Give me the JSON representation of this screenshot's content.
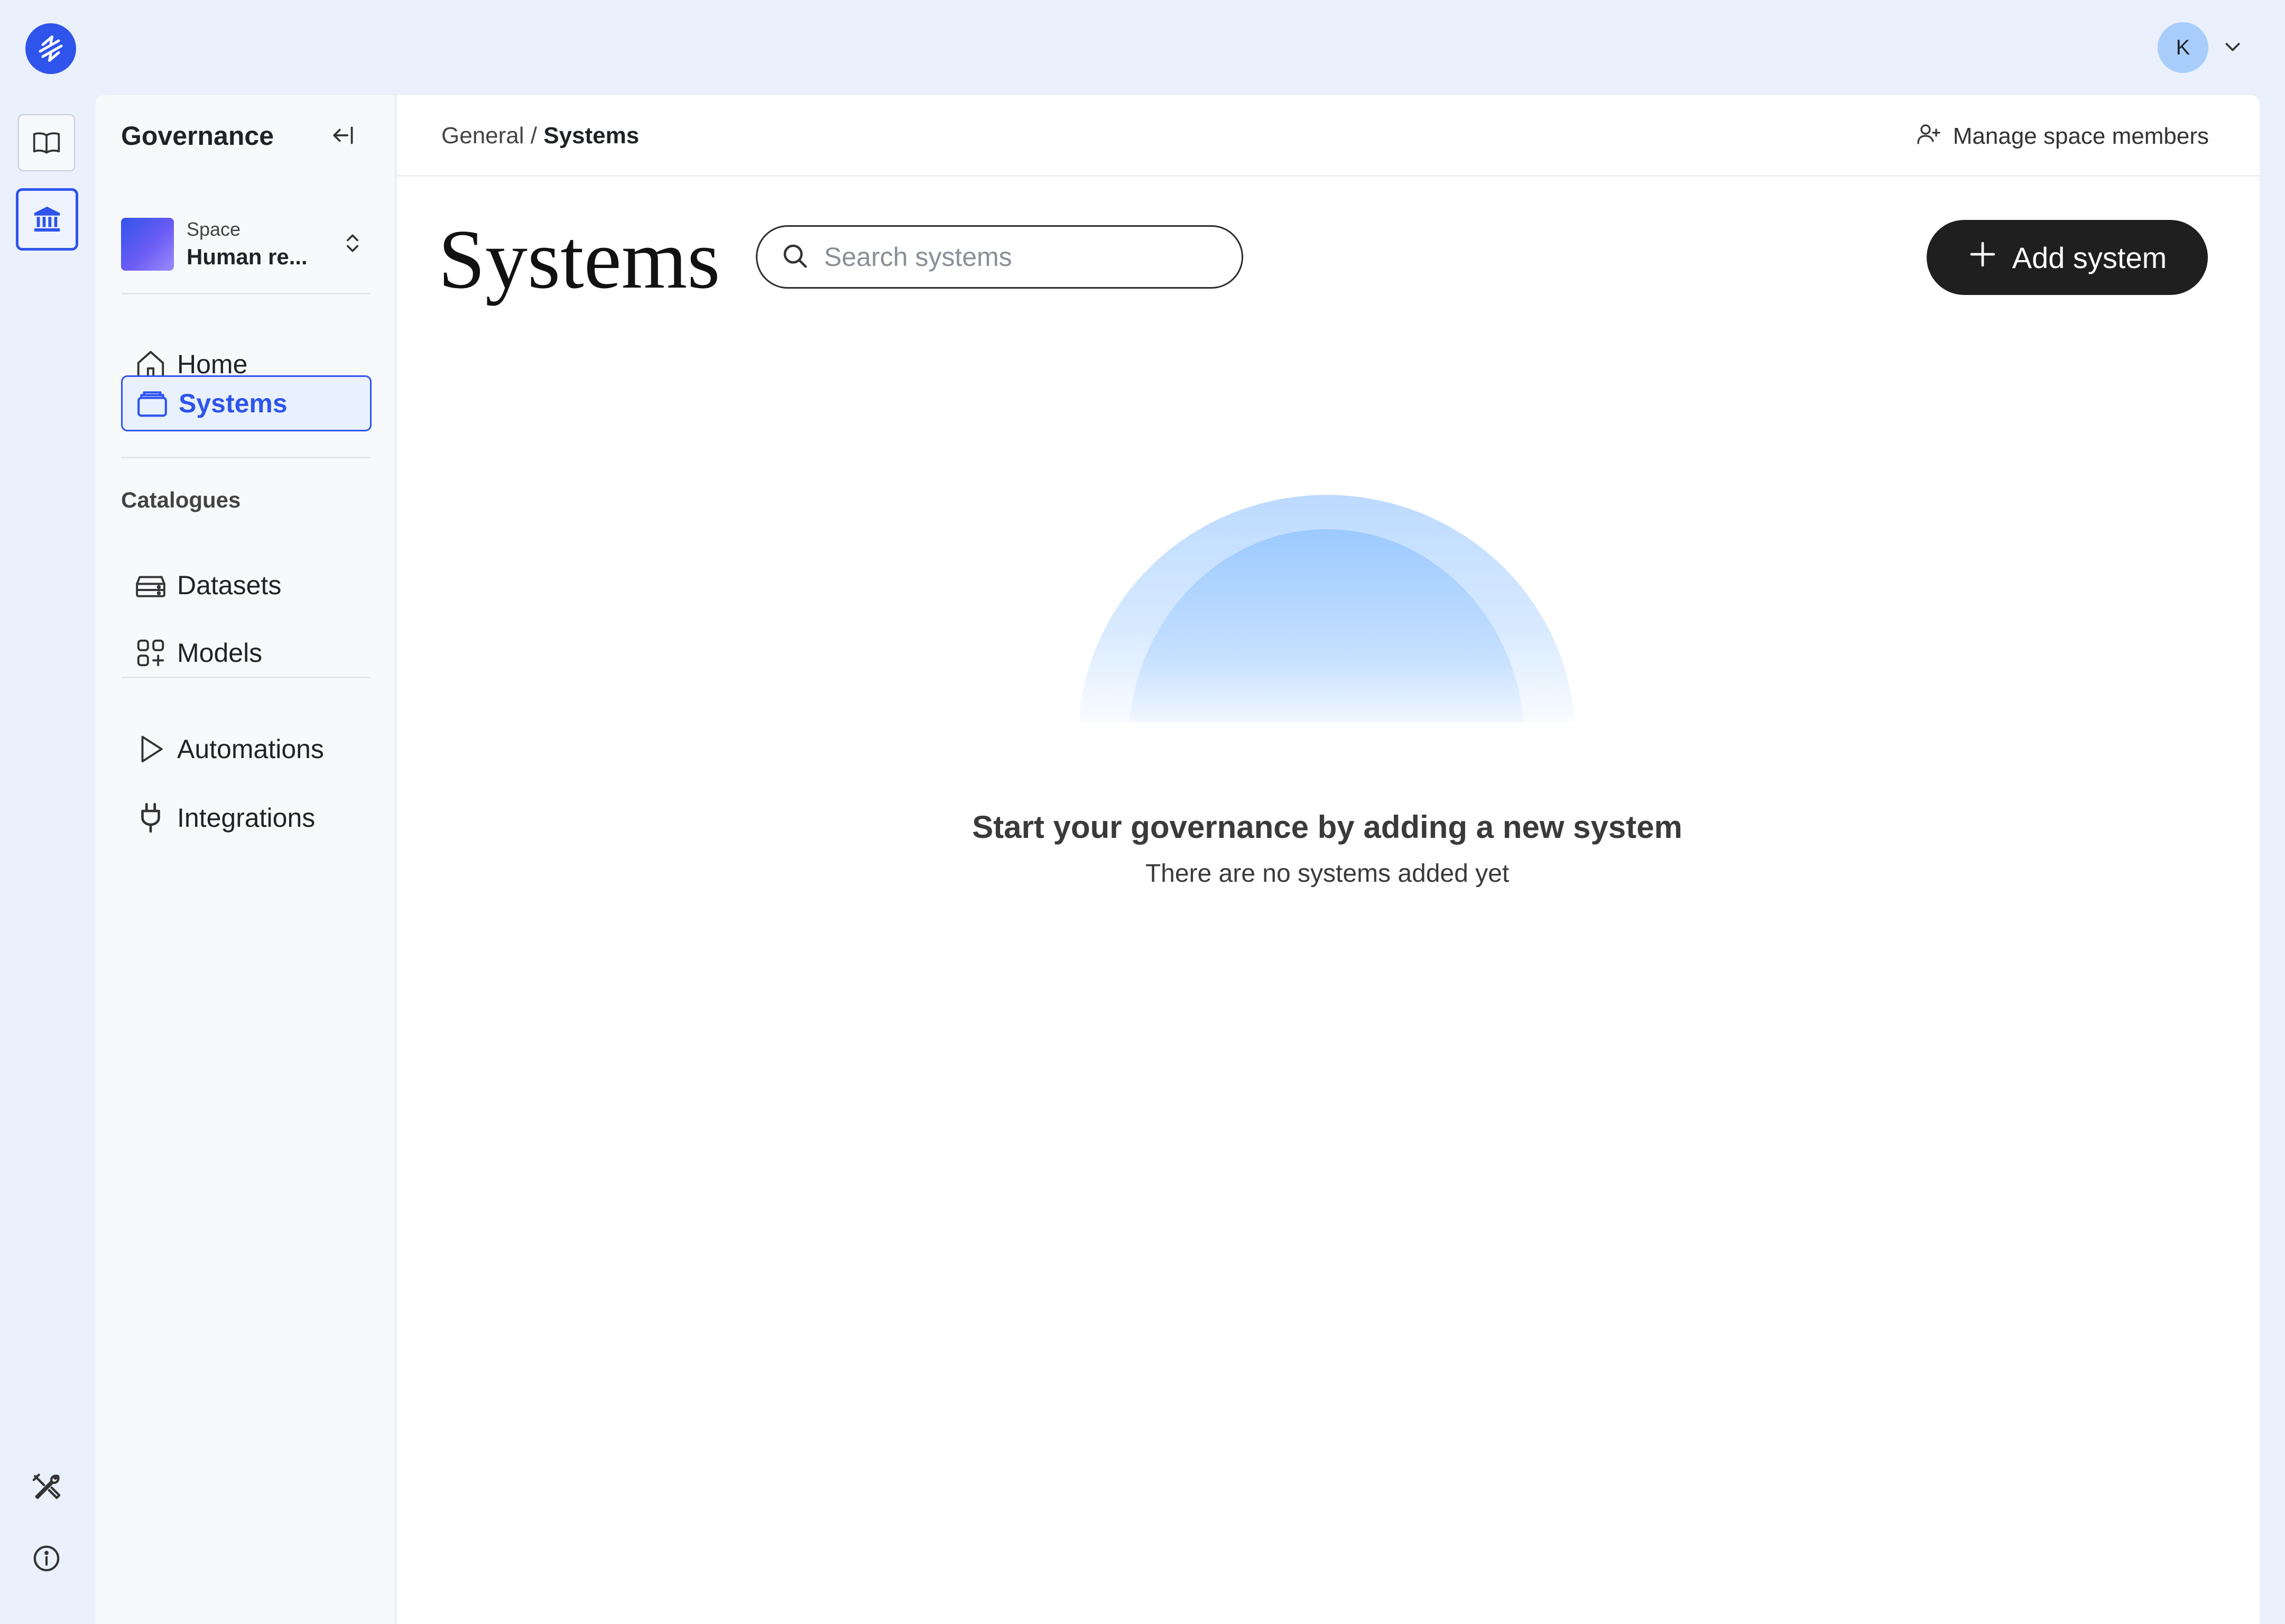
{
  "topbar": {
    "avatar_initial": "K"
  },
  "sidebar": {
    "title": "Governance",
    "space": {
      "label": "Space",
      "name": "Human re..."
    },
    "nav": [
      {
        "label": "Home"
      },
      {
        "label": "Systems",
        "active": true
      }
    ],
    "catalogues_label": "Catalogues",
    "catalogues": [
      {
        "label": "Datasets"
      },
      {
        "label": "Models"
      }
    ],
    "tools": [
      {
        "label": "Automations"
      },
      {
        "label": "Integrations"
      }
    ]
  },
  "main": {
    "breadcrumb": {
      "parent": "General",
      "separator": " / ",
      "current": "Systems"
    },
    "manage_members": "Manage space members",
    "title": "Systems",
    "search": {
      "placeholder": "Search systems",
      "value": ""
    },
    "add_button": "Add system",
    "empty_state": {
      "title": "Start your governance by adding a new system",
      "subtitle": "There are no systems added yet"
    }
  },
  "colors": {
    "accent": "#2f54eb",
    "background": "#eaf1fd",
    "button_dark": "#1f1f1f",
    "avatar": "#a9cdfb"
  },
  "icons": [
    "logo-icon",
    "book-icon",
    "bank-icon",
    "tools-icon",
    "info-icon",
    "chevron-down-icon",
    "collapse-sidebar-icon",
    "updown-chevron-icon",
    "home-icon",
    "systems-icon",
    "datasets-icon",
    "models-icon",
    "play-icon",
    "plug-icon",
    "add-user-icon",
    "search-icon",
    "plus-icon"
  ]
}
